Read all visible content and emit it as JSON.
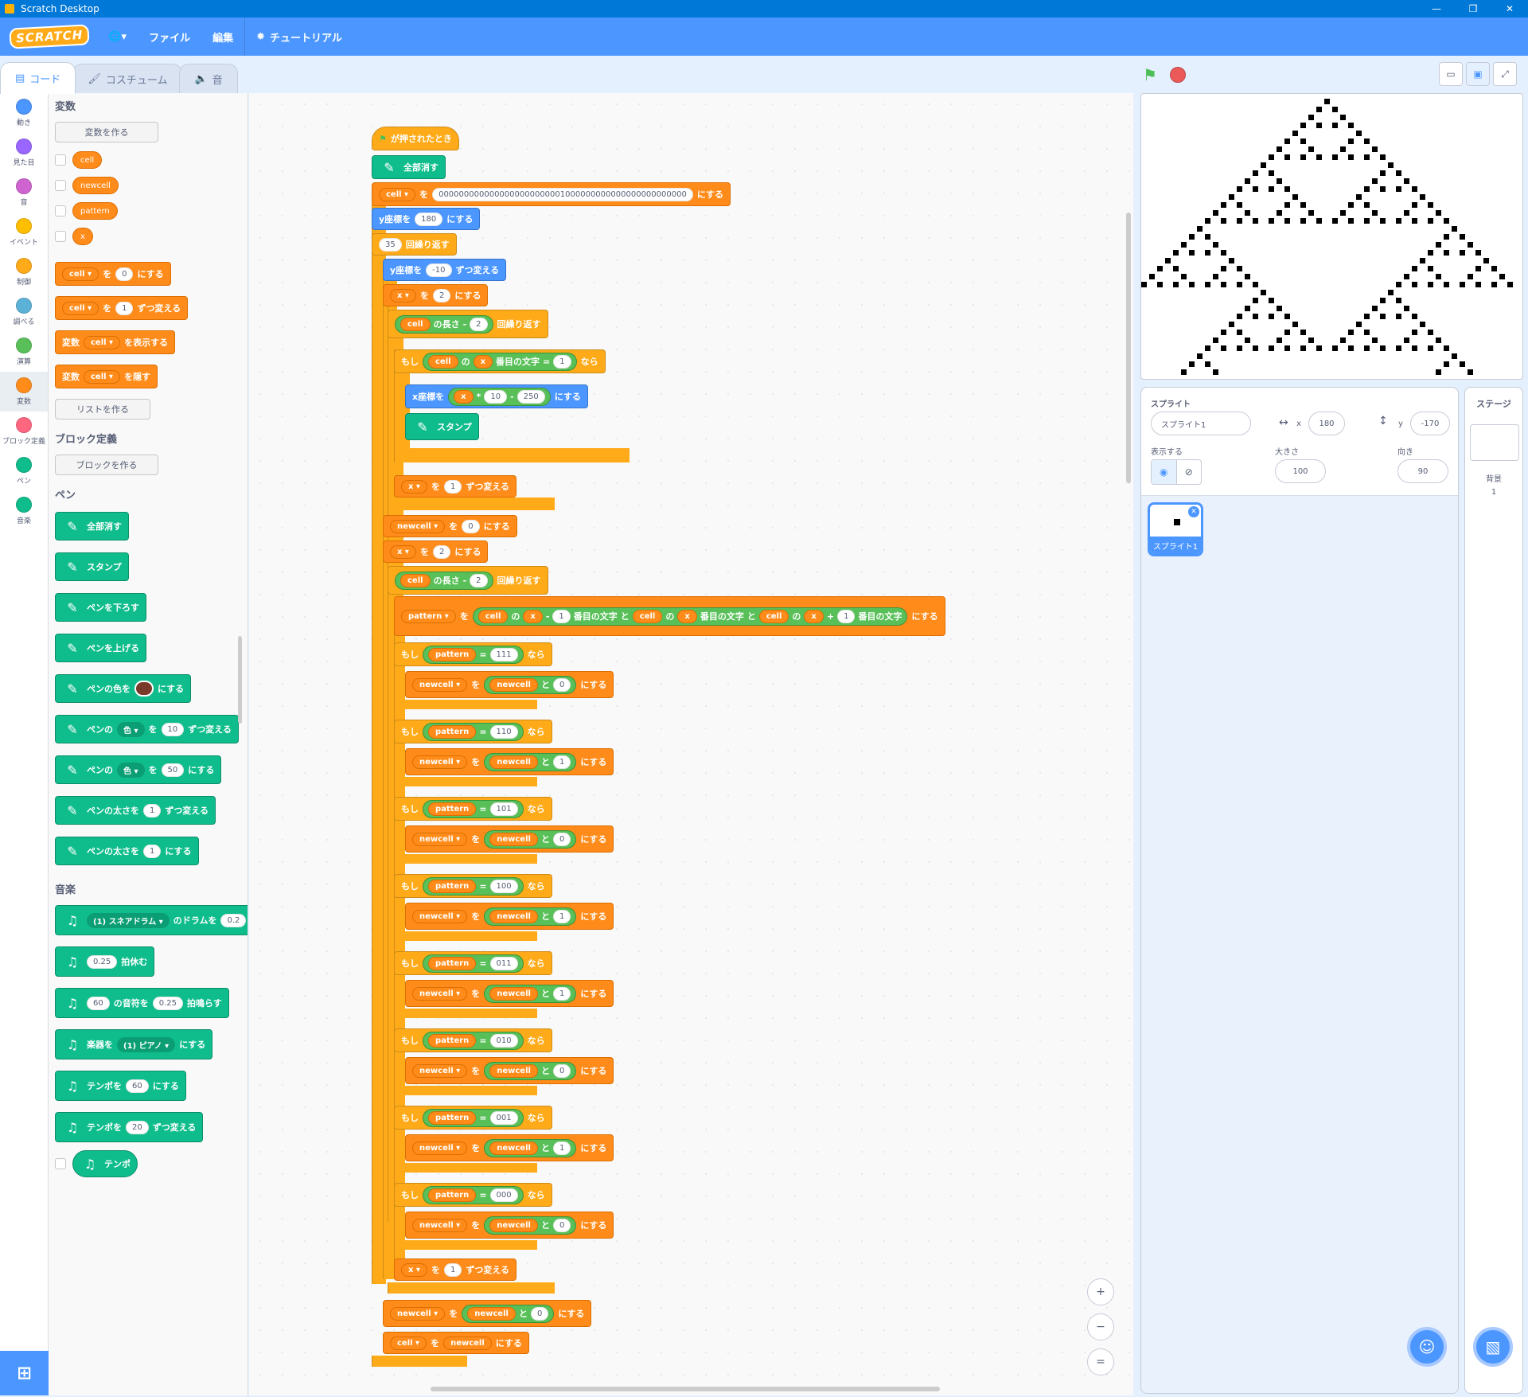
{
  "window": {
    "title": "Scratch Desktop",
    "min": "—",
    "max": "❐",
    "close": "✕"
  },
  "menu": {
    "logo": "SCRATCH",
    "lang": "🌐▾",
    "file": "ファイル",
    "edit": "編集",
    "tutorial": "チュートリアル"
  },
  "tabs": {
    "code": "コード",
    "costume": "コスチューム",
    "sound": "音"
  },
  "categories": [
    {
      "label": "動き",
      "color": "#4c97ff"
    },
    {
      "label": "見た目",
      "color": "#9966ff"
    },
    {
      "label": "音",
      "color": "#cf63cf"
    },
    {
      "label": "イベント",
      "color": "#ffbf00"
    },
    {
      "label": "制御",
      "color": "#ffab19"
    },
    {
      "label": "調べる",
      "color": "#5cb1d6"
    },
    {
      "label": "演算",
      "color": "#59c059"
    },
    {
      "label": "変数",
      "color": "#ff8c1a"
    },
    {
      "label": "ブロック定義",
      "color": "#ff6680"
    },
    {
      "label": "ペン",
      "color": "#0fbd8c"
    },
    {
      "label": "音楽",
      "color": "#0fbd8c"
    }
  ],
  "palette": {
    "vars_title": "変数",
    "make_var": "変数を作る",
    "vars": [
      "cell",
      "newcell",
      "pattern",
      "x"
    ],
    "set_to": [
      "cell ▾",
      "を",
      "0",
      "にする"
    ],
    "change_by": [
      "cell ▾",
      "を",
      "1",
      "ずつ変える"
    ],
    "show_var": [
      "変数",
      "cell ▾",
      "を表示する"
    ],
    "hide_var": [
      "変数",
      "cell ▾",
      "を隠す"
    ],
    "make_list": "リストを作る",
    "myblocks_title": "ブロック定義",
    "make_block": "ブロックを作る",
    "pen_title": "ペン",
    "pen_blocks": [
      "全部消す",
      "スタンプ",
      "ペンを下ろす",
      "ペンを上げる"
    ],
    "pen_color_a": "ペンの色を",
    "pen_color_b": "にする",
    "pen_change": [
      "ペンの",
      "色 ▾",
      "を",
      "10",
      "ずつ変える"
    ],
    "pen_set": [
      "ペンの",
      "色 ▾",
      "を",
      "50",
      "にする"
    ],
    "pen_size_change": [
      "ペンの太さを",
      "1",
      "ずつ変える"
    ],
    "pen_size_set": [
      "ペンの太さを",
      "1",
      "にする"
    ],
    "music_title": "音楽",
    "drum": [
      "(1) スネアドラム ▾",
      "のドラムを",
      "0.2"
    ],
    "rest": [
      "0.25",
      "拍休む"
    ],
    "note": [
      "60",
      "の音符を",
      "0.25",
      "拍鳴らす"
    ],
    "instr": [
      "楽器を",
      "(1) ピアノ ▾",
      "にする"
    ],
    "tempo_set": [
      "テンポを",
      "60",
      "にする"
    ],
    "tempo_change": [
      "テンポを",
      "20",
      "ずつ変える"
    ],
    "tempo": "テンポ"
  },
  "script": {
    "hat": "が押されたとき",
    "clear": "全部消す",
    "set_cell": [
      "cell ▾",
      "を",
      "0000000000000000000000001000000000000000000000000",
      "にする"
    ],
    "sety": [
      "y座標を",
      "180",
      "にする"
    ],
    "repeat35": [
      "35",
      "回繰り返す"
    ],
    "changey": [
      "y座標を",
      "-10",
      "ずつ変える"
    ],
    "setx2": [
      "x ▾",
      "を",
      "2",
      "にする"
    ],
    "rep_len": [
      "cell",
      "の長さ",
      "-",
      "2",
      "回繰り返す"
    ],
    "if1": [
      "もし",
      "cell",
      "の",
      "x",
      "番目の文字",
      "=",
      "1",
      "なら"
    ],
    "setxpos": [
      "x座標を",
      "x",
      "*",
      "10",
      "-",
      "250",
      "にする"
    ],
    "stamp": "スタンプ",
    "incx": [
      "x ▾",
      "を",
      "1",
      "ずつ変える"
    ],
    "set_newcell": [
      "newcell ▾",
      "を",
      "0",
      "にする"
    ],
    "pattern": [
      "pattern ▾",
      "を",
      "cell",
      "の",
      "x",
      "-",
      "1",
      "番目の文字",
      "と",
      "cell",
      "の",
      "x",
      "番目の文字",
      "と",
      "cell",
      "の",
      "x",
      "+",
      "1",
      "番目の文字",
      "にする"
    ],
    "ifs": [
      {
        "p": "111",
        "v": "0"
      },
      {
        "p": "110",
        "v": "1"
      },
      {
        "p": "101",
        "v": "0"
      },
      {
        "p": "100",
        "v": "1"
      },
      {
        "p": "011",
        "v": "1"
      },
      {
        "p": "010",
        "v": "0"
      },
      {
        "p": "001",
        "v": "1"
      },
      {
        "p": "000",
        "v": "0"
      }
    ],
    "if_words": [
      "もし",
      "pattern",
      "=",
      "なら"
    ],
    "set_words": [
      "newcell ▾",
      "を",
      "newcell",
      "と",
      "にする"
    ],
    "final_newcell": [
      "newcell ▾",
      "を",
      "newcell",
      "と",
      "0",
      "にする"
    ],
    "final_cell": [
      "cell ▾",
      "を",
      "newcell",
      "にする"
    ]
  },
  "zoom": {
    "in": "+",
    "out": "−",
    "reset": "="
  },
  "sprite": {
    "label": "スプライト",
    "name": "スプライト1",
    "x_label": "x",
    "x": "180",
    "y_label": "y",
    "y": "-170",
    "show_label": "表示する",
    "size_label": "大きさ",
    "size": "100",
    "dir_label": "向き",
    "dir": "90",
    "thumb_name": "スプライト1"
  },
  "stage_pane": {
    "title": "ステージ",
    "backdrops_label": "背景",
    "backdrops": "1"
  },
  "stage_pattern_rows": [
    "0000000000000000000000001000000000000000000000000",
    "0000000000000000000000010100000000000000000000000",
    "0000000000000000000000100010000000000000000000000",
    "0000000000000000000001010101000000000000000000000",
    "0000000000000000000010000000100000000000000000000",
    "0000000000000000000101000001010000000000000000000",
    "0000000000000000001000100010001000000000000000000",
    "0000000000000000010101010101010100000000000000000",
    "0000000000000000100000000000000010000000000000000",
    "0000000000000001010000000000000101000000000000000",
    "0000000000000010001000000000001000100000000000000",
    "0000000000000101010100000000010101010000000000000",
    "0000000000001000000010000000100000001000000000000",
    "0000000000010100000101000001010000010100000000000",
    "0000000000100010001000100010001000100010000000000",
    "0000000001010101010101010101010101010101000000000",
    "0000000010000000000000000000000000000000100000000",
    "0000000101000000000000000000000000000001010000000",
    "0000001000100000000000000000000000000010001000000",
    "0000010101010000000000000000000000000101010100000",
    "0000100000001000000000000000000000001000000010000",
    "0001010000010100000000000000000000010100000101000",
    "0010001000100010000000000000000000100010001000100",
    "0101010101010101000000000000000001010101010101010",
    "0000000000000000100000000000000010000000000000000",
    "0000000000000001010000000000000101000000000000000",
    "0000000000000010001000000000001000100000000000000",
    "0000000000000101010100000000010101010000000000000",
    "0000000000001000000010000000100000001000000000000",
    "0000000000010100000101000001010000010100000000000",
    "0000000000100010001000100010001000100010000000000",
    "0000000001010101010101010101010101010101000000000",
    "0000000010000000000000000000000000000000100000000",
    "0000000101000000000000000000000000000001010000000",
    "0000001000100000000000000000000000000010001000000"
  ]
}
